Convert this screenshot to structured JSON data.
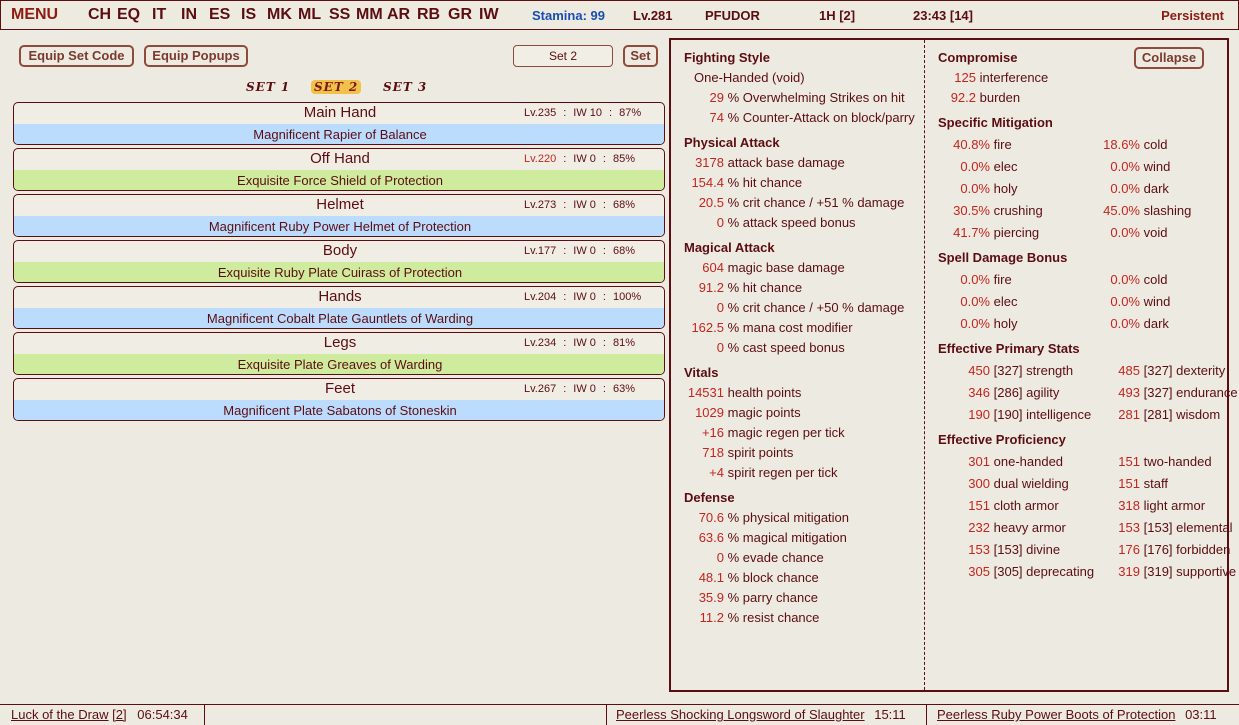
{
  "topbar": {
    "menu": "MENU",
    "nav": [
      "CH",
      "EQ",
      "IT",
      "IN",
      "ES",
      "IS",
      "MK",
      "ML",
      "SS",
      "MM",
      "AR",
      "RB",
      "GR",
      "IW"
    ],
    "stamina": "Stamina: 99",
    "level": "Lv.281",
    "player": "PFUDOR",
    "hand": "1H [2]",
    "time": "23:43 [14]",
    "persistent": "Persistent"
  },
  "controls": {
    "equip_set_code": "Equip Set Code",
    "equip_popups": "Equip Popups",
    "set_input_value": "Set 2",
    "set_button": "Set",
    "sets": [
      "SET 1",
      "SET 2",
      "SET 3"
    ]
  },
  "slots": [
    {
      "slot": "Main Hand",
      "lv": "Lv.235",
      "iw": "IW 10",
      "pct": "87%",
      "item": "Magnificent Rapier of Balance",
      "color": "blue",
      "lv_red": false
    },
    {
      "slot": "Off Hand",
      "lv": "Lv.220",
      "iw": "IW 0",
      "pct": "85%",
      "item": "Exquisite Force Shield of Protection",
      "color": "green",
      "lv_red": true
    },
    {
      "slot": "Helmet",
      "lv": "Lv.273",
      "iw": "IW 0",
      "pct": "68%",
      "item": "Magnificent Ruby Power Helmet of Protection",
      "color": "blue",
      "lv_red": false
    },
    {
      "slot": "Body",
      "lv": "Lv.177",
      "iw": "IW 0",
      "pct": "68%",
      "item": "Exquisite Ruby Plate Cuirass of Protection",
      "color": "green",
      "lv_red": false
    },
    {
      "slot": "Hands",
      "lv": "Lv.204",
      "iw": "IW 0",
      "pct": "100%",
      "item": "Magnificent Cobalt Plate Gauntlets of Warding",
      "color": "blue",
      "lv_red": false
    },
    {
      "slot": "Legs",
      "lv": "Lv.234",
      "iw": "IW 0",
      "pct": "81%",
      "item": "Exquisite Plate Greaves of Warding",
      "color": "green",
      "lv_red": false
    },
    {
      "slot": "Feet",
      "lv": "Lv.267",
      "iw": "IW 0",
      "pct": "63%",
      "item": "Magnificent Plate Sabatons of Stoneskin",
      "color": "blue",
      "lv_red": false
    }
  ],
  "stats_left": {
    "fighting_style": {
      "title": "Fighting Style",
      "style": "One-Handed (void)",
      "rows": [
        {
          "v": "29",
          "l": "% Overwhelming Strikes on hit"
        },
        {
          "v": "74",
          "l": "% Counter-Attack on block/parry"
        }
      ]
    },
    "physical_attack": {
      "title": "Physical Attack",
      "rows": [
        {
          "v": "3178",
          "l": "attack base damage"
        },
        {
          "v": "154.4",
          "l": "% hit chance"
        },
        {
          "v": "20.5",
          "l": "% crit chance / +51 % damage"
        },
        {
          "v": "0",
          "l": "% attack speed bonus"
        }
      ]
    },
    "magical_attack": {
      "title": "Magical Attack",
      "rows": [
        {
          "v": "604",
          "l": "magic base damage"
        },
        {
          "v": "91.2",
          "l": "% hit chance"
        },
        {
          "v": "0",
          "l": "% crit chance / +50 % damage"
        },
        {
          "v": "162.5",
          "l": "% mana cost modifier"
        },
        {
          "v": "0",
          "l": "% cast speed bonus"
        }
      ]
    },
    "vitals": {
      "title": "Vitals",
      "rows": [
        {
          "v": "14531",
          "l": "health points"
        },
        {
          "v": "1029",
          "l": "magic points"
        },
        {
          "v": "+16",
          "l": "magic regen per tick"
        },
        {
          "v": "718",
          "l": "spirit points"
        },
        {
          "v": "+4",
          "l": "spirit regen per tick"
        }
      ]
    },
    "defense": {
      "title": "Defense",
      "rows": [
        {
          "v": "70.6",
          "l": "% physical mitigation"
        },
        {
          "v": "63.6",
          "l": "% magical mitigation"
        },
        {
          "v": "0",
          "l": "% evade chance"
        },
        {
          "v": "48.1",
          "l": "% block chance"
        },
        {
          "v": "35.9",
          "l": "% parry chance"
        },
        {
          "v": "11.2",
          "l": "% resist chance"
        }
      ]
    }
  },
  "stats_right": {
    "compromise": {
      "title": "Compromise",
      "collapse": "Collapse",
      "rows": [
        {
          "v": "125",
          "l": "interference"
        },
        {
          "v": "92.2",
          "l": "burden"
        }
      ]
    },
    "specific_mitigation": {
      "title": "Specific Mitigation",
      "pairs": [
        [
          {
            "v": "40.8%",
            "l": "fire"
          },
          {
            "v": "18.6%",
            "l": "cold"
          }
        ],
        [
          {
            "v": "0.0%",
            "l": "elec"
          },
          {
            "v": "0.0%",
            "l": "wind"
          }
        ],
        [
          {
            "v": "0.0%",
            "l": "holy"
          },
          {
            "v": "0.0%",
            "l": "dark"
          }
        ],
        [
          {
            "v": "30.5%",
            "l": "crushing"
          },
          {
            "v": "45.0%",
            "l": "slashing"
          }
        ],
        [
          {
            "v": "41.7%",
            "l": "piercing"
          },
          {
            "v": "0.0%",
            "l": "void"
          }
        ]
      ]
    },
    "spell_damage_bonus": {
      "title": "Spell Damage Bonus",
      "pairs": [
        [
          {
            "v": "0.0%",
            "l": "fire"
          },
          {
            "v": "0.0%",
            "l": "cold"
          }
        ],
        [
          {
            "v": "0.0%",
            "l": "elec"
          },
          {
            "v": "0.0%",
            "l": "wind"
          }
        ],
        [
          {
            "v": "0.0%",
            "l": "holy"
          },
          {
            "v": "0.0%",
            "l": "dark"
          }
        ]
      ]
    },
    "effective_primary_stats": {
      "title": "Effective Primary Stats",
      "pairs": [
        [
          {
            "v": "450",
            "l": "[327] strength"
          },
          {
            "v": "485",
            "l": "[327] dexterity"
          }
        ],
        [
          {
            "v": "346",
            "l": "[286] agility"
          },
          {
            "v": "493",
            "l": "[327] endurance"
          }
        ],
        [
          {
            "v": "190",
            "l": "[190] intelligence"
          },
          {
            "v": "281",
            "l": "[281] wisdom"
          }
        ]
      ]
    },
    "effective_proficiency": {
      "title": "Effective Proficiency",
      "pairs": [
        [
          {
            "v": "301",
            "l": "one-handed"
          },
          {
            "v": "151",
            "l": "two-handed"
          }
        ],
        [
          {
            "v": "300",
            "l": "dual wielding"
          },
          {
            "v": "151",
            "l": "staff"
          }
        ],
        [
          {
            "v": "151",
            "l": "cloth armor"
          },
          {
            "v": "318",
            "l": "light armor"
          }
        ],
        [
          {
            "v": "232",
            "l": "heavy armor"
          },
          {
            "v": "153",
            "l": "[153] elemental"
          }
        ],
        [
          {
            "v": "153",
            "l": "[153] divine"
          },
          {
            "v": "176",
            "l": "[176] forbidden"
          }
        ],
        [
          {
            "v": "305",
            "l": "[305] deprecating"
          },
          {
            "v": "319",
            "l": "[319] supportive"
          }
        ]
      ]
    }
  },
  "bottombar": {
    "effect_name": "Luck of the Draw",
    "effect_stack": "[2]",
    "effect_time": "06:54:34",
    "item1_name": "Peerless Shocking Longsword of Slaughter",
    "item1_time": "15:11",
    "item2_name": "Peerless Ruby Power Boots of Protection",
    "item2_time": "03:11"
  }
}
